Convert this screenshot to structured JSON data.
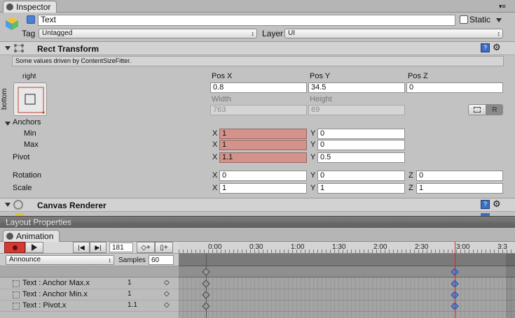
{
  "inspector": {
    "tab_label": "Inspector",
    "object_name": "Text",
    "static_label": "Static",
    "tag_label": "Tag",
    "tag_value": "Untagged",
    "layer_label": "Layer",
    "layer_value": "UI"
  },
  "rect_transform": {
    "title": "Rect Transform",
    "info": "Some values driven by ContentSizeFitter.",
    "anchor_h": "right",
    "anchor_v": "bottom",
    "pos_x_label": "Pos X",
    "pos_y_label": "Pos Y",
    "pos_z_label": "Pos Z",
    "pos_x": "0.8",
    "pos_y": "34.5",
    "pos_z": "0",
    "width_label": "Width",
    "height_label": "Height",
    "width": "763",
    "height": "69",
    "r_button": "R",
    "anchors_label": "Anchors",
    "min_label": "Min",
    "max_label": "Max",
    "pivot_label": "Pivot",
    "rotation_label": "Rotation",
    "scale_label": "Scale",
    "x": "X",
    "y": "Y",
    "z": "Z",
    "min_x": "1",
    "min_y": "0",
    "max_x": "1",
    "max_y": "0",
    "pivot_x": "1.1",
    "pivot_y": "0.5",
    "rot_x": "0",
    "rot_y": "0",
    "rot_z": "0",
    "scale_x": "1",
    "scale_y": "1",
    "scale_z": "1"
  },
  "canvas_renderer": {
    "title": "Canvas Renderer"
  },
  "layout_properties": {
    "title": "Layout Properties"
  },
  "animation": {
    "tab_label": "Animation",
    "frame": "181",
    "clip": "Announce",
    "samples_label": "Samples",
    "samples": "60",
    "ticks": [
      "0:00",
      "0:30",
      "1:00",
      "1:30",
      "2:00",
      "2:30",
      "3:00",
      "3:3"
    ],
    "properties": [
      {
        "name": "Text : Anchor Max.x",
        "value": "1"
      },
      {
        "name": "Text : Anchor Min.x",
        "value": "1"
      },
      {
        "name": "Text : Pivot.x",
        "value": "1.1"
      }
    ]
  }
}
